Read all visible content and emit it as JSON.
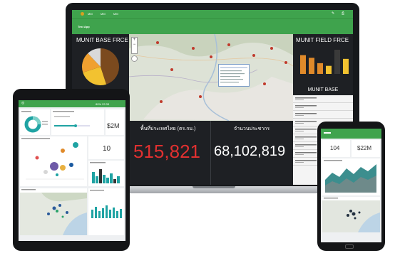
{
  "laptop": {
    "topbar": {
      "items": [
        "MM",
        "MM",
        "MM"
      ]
    },
    "app_title": "Test App",
    "left_panel_title": "MUNIT BASE FRCE",
    "right_panel_title": "MUNIT FIELD FRCE",
    "right_list_title": "MUNIT BASE",
    "stat1": {
      "label": "พื้นที่ประเทศไทย (ตร.กม.)",
      "value": "515,821"
    },
    "stat2": {
      "label": "จำนวนประชากร",
      "value": "68,102,819"
    },
    "pie": {
      "slices": [
        45,
        25,
        18,
        12
      ],
      "colors": [
        "#7b4a1e",
        "#f2c230",
        "#f0a030",
        "#d9d9d9"
      ]
    },
    "bars": {
      "values": [
        35,
        30,
        20,
        15,
        45,
        28
      ],
      "colors": [
        "#e08a2a",
        "#e08a2a",
        "#e08a2a",
        "#f2c230",
        "#3a3a3a",
        "#f2c230"
      ]
    }
  },
  "tablet": {
    "status_text": "80% 22:33",
    "kpi_money": "$2M",
    "kpi_count": "10"
  },
  "phone": {
    "kpi_count": "104",
    "kpi_money": "$22M"
  },
  "colors": {
    "accent": "#3fa34d",
    "dark": "#1e2024",
    "red": "#e03030"
  }
}
